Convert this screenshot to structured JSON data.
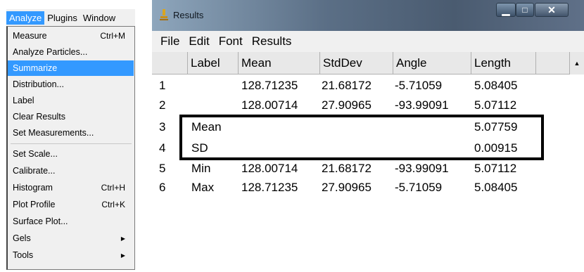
{
  "menubar": {
    "items": [
      "Analyze",
      "Plugins",
      "Window"
    ]
  },
  "analyze_menu": {
    "items": [
      {
        "label": "Measure",
        "shortcut": "Ctrl+M"
      },
      {
        "label": "Analyze Particles...",
        "shortcut": ""
      },
      {
        "label": "Summarize",
        "shortcut": ""
      },
      {
        "label": "Distribution...",
        "shortcut": ""
      },
      {
        "label": "Label",
        "shortcut": ""
      },
      {
        "label": "Clear Results",
        "shortcut": ""
      },
      {
        "label": "Set Measurements...",
        "shortcut": ""
      },
      {
        "label": "Set Scale...",
        "shortcut": ""
      },
      {
        "label": "Calibrate...",
        "shortcut": ""
      },
      {
        "label": "Histogram",
        "shortcut": "Ctrl+H"
      },
      {
        "label": "Plot Profile",
        "shortcut": "Ctrl+K"
      },
      {
        "label": "Surface Plot...",
        "shortcut": ""
      },
      {
        "label": "Gels",
        "shortcut": ""
      },
      {
        "label": "Tools",
        "shortcut": ""
      }
    ],
    "selected": "Summarize"
  },
  "results_window": {
    "title": "Results",
    "menu": [
      "File",
      "Edit",
      "Font",
      "Results"
    ],
    "columns": [
      "",
      "Label",
      "Mean",
      "StdDev",
      "Angle",
      "Length"
    ],
    "rows": [
      [
        "1",
        "",
        "128.71235",
        "21.68172",
        "-5.71059",
        "5.08405"
      ],
      [
        "2",
        "",
        "128.00714",
        "27.90965",
        "-93.99091",
        "5.07112"
      ],
      [
        "3",
        "Mean",
        "",
        "",
        "",
        "5.07759"
      ],
      [
        "4",
        "SD",
        "",
        "",
        "",
        "0.00915"
      ],
      [
        "5",
        "Min",
        "128.00714",
        "21.68172",
        "-93.99091",
        "5.07112"
      ],
      [
        "6",
        "Max",
        "128.71235",
        "27.90965",
        "-5.71059",
        "5.08405"
      ]
    ]
  },
  "colors": {
    "selection": "#3399ff",
    "titlebar": "#5b6f86",
    "highlight_border": "#000000"
  }
}
